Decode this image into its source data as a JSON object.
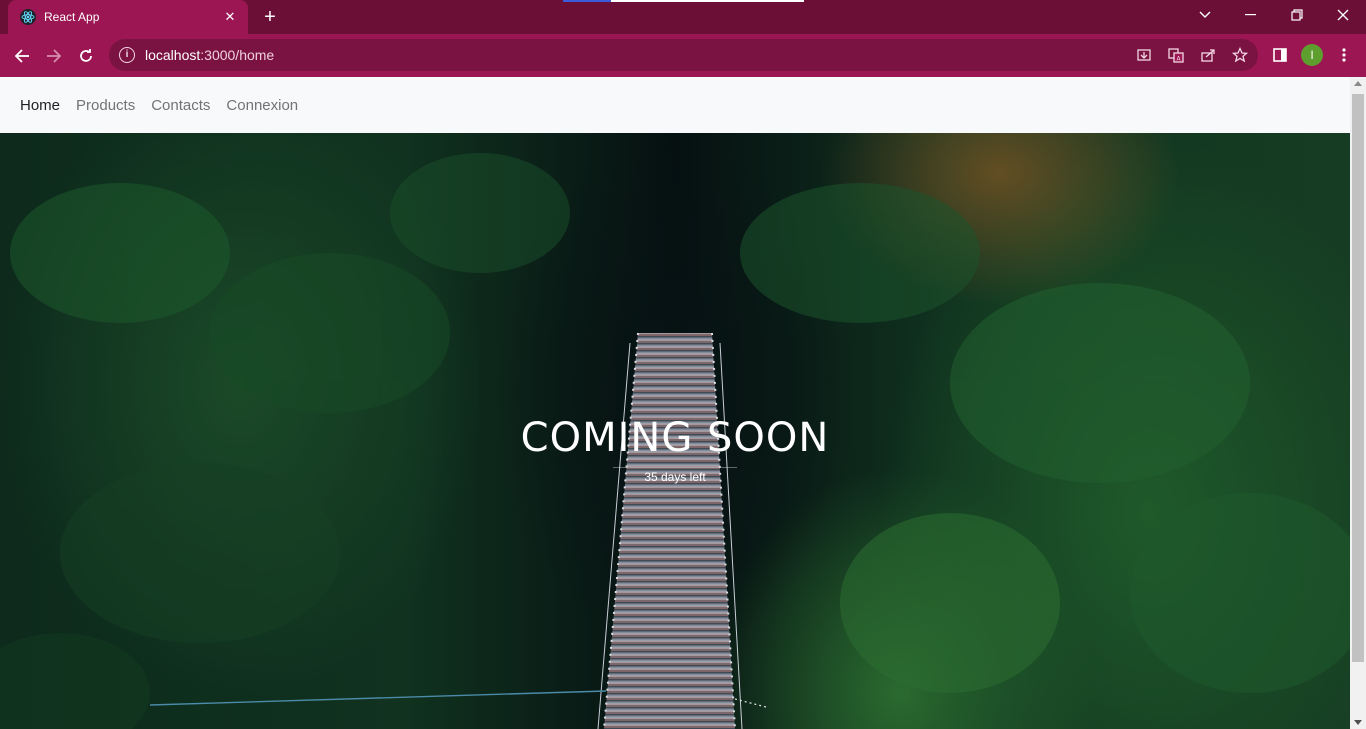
{
  "browser": {
    "tab_title": "React App",
    "url_host": "localhost",
    "url_path": ":3000/home",
    "profile_initial": "I",
    "accent_color": "#9b1652",
    "tabbar_color": "#6b0f36"
  },
  "icons": {
    "favicon": "react-icon",
    "tab_close": "close-icon",
    "new_tab": "plus-icon",
    "back": "back-arrow-icon",
    "forward": "forward-arrow-icon",
    "reload": "reload-icon",
    "site_info": "info-icon",
    "install": "install-icon",
    "translate": "translate-icon",
    "share": "share-icon",
    "bookmark": "star-icon",
    "side_panel": "side-panel-icon",
    "menu": "kebab-menu-icon"
  },
  "navbar": {
    "items": [
      {
        "label": "Home",
        "active": true
      },
      {
        "label": "Products",
        "active": false
      },
      {
        "label": "Contacts",
        "active": false
      },
      {
        "label": "Connexion",
        "active": false
      }
    ]
  },
  "hero": {
    "title": "COMING SOON",
    "subtitle": "35 days left"
  }
}
